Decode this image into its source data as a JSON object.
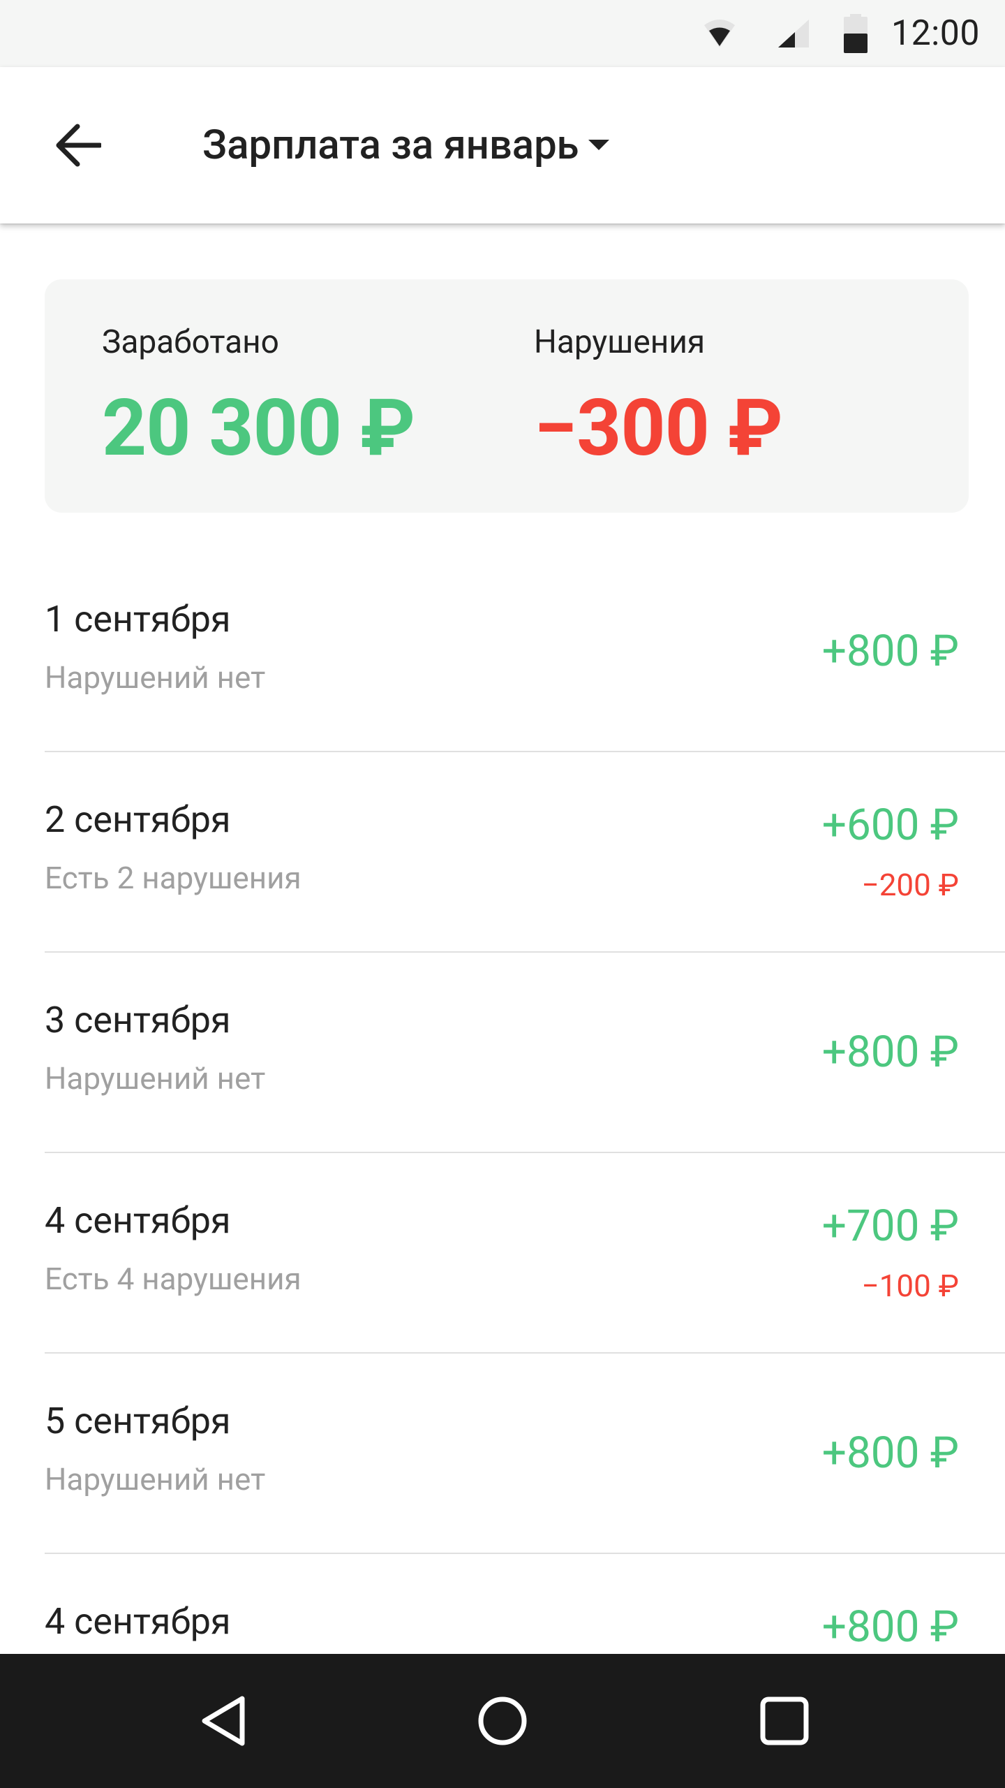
{
  "status_bar": {
    "time": "12:00",
    "icons": [
      "wifi-icon",
      "cell-signal-icon",
      "battery-icon"
    ]
  },
  "app_bar": {
    "title": "Зарплата за январь",
    "back_icon": "arrow-back-icon",
    "title_dropdown_icon": "caret-down-icon"
  },
  "summary": {
    "earned_label": "Заработано",
    "earned_value": "20 300 ₽",
    "violations_label": "Нарушения",
    "violations_value": "−300 ₽"
  },
  "days": [
    {
      "date": "1 сентября",
      "status": "Нарушений нет",
      "amount": "+800 ₽",
      "penalty": null
    },
    {
      "date": "2 сентября",
      "status": "Есть 2 нарушения",
      "amount": "+600 ₽",
      "penalty": "−200 ₽"
    },
    {
      "date": "3 сентября",
      "status": "Нарушений нет",
      "amount": "+800 ₽",
      "penalty": null
    },
    {
      "date": "4 сентября",
      "status": "Есть 4 нарушения",
      "amount": "+700 ₽",
      "penalty": "−100 ₽"
    },
    {
      "date": "5 сентября",
      "status": "Нарушений нет",
      "amount": "+800 ₽",
      "penalty": null
    },
    {
      "date": "4 сентября",
      "status": "",
      "amount": "+800 ₽",
      "penalty": null
    }
  ],
  "nav_bar": {
    "buttons": [
      "nav-back-icon",
      "nav-home-icon",
      "nav-recents-icon"
    ]
  },
  "colors": {
    "positive": "#4cc77f",
    "negative": "#f44336",
    "muted_text": "#a0a0a0",
    "card_background": "#f5f6f5",
    "nav_background": "#1a1a1a"
  }
}
